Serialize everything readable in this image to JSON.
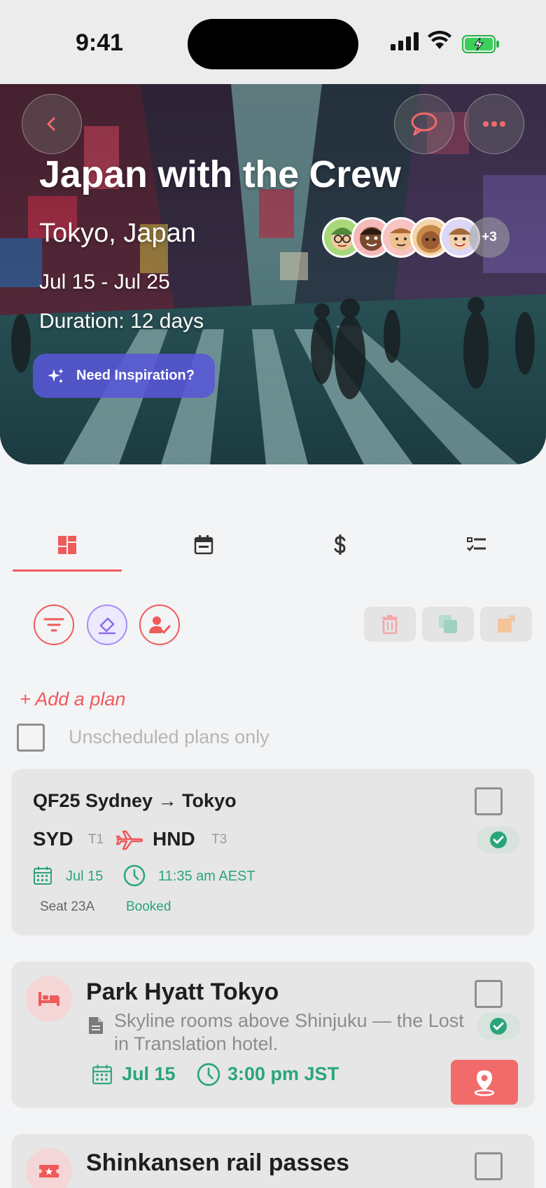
{
  "status_bar": {
    "time": "9:41"
  },
  "hero": {
    "title": "Japan with the Crew",
    "location": "Tokyo, Japan",
    "dates": "Jul 15 - Jul 25",
    "duration": "Duration: 12 days",
    "inspire_label": "Need Inspiration?",
    "more_avatars": "+3"
  },
  "tabs": [
    "dashboard-icon",
    "calendar-icon",
    "dollar-icon",
    "checklist-icon"
  ],
  "add_plan": "+ Add a plan",
  "unscheduled_label": "Unscheduled plans only",
  "flight": {
    "title": "QF25 Sydney → Tokyo",
    "from_code": "SYD",
    "from_term": "T1",
    "to_code": "HND",
    "to_term": "T3",
    "date": "Jul 15",
    "time": "11:35 am AEST",
    "seat": "Seat 23A",
    "status": "Booked"
  },
  "hotel": {
    "title": "Park Hyatt Tokyo",
    "description": "Skyline rooms above Shinjuku — the Lost in Translation hotel.",
    "date": "Jul 15",
    "time": "3:00 pm JST"
  },
  "rail": {
    "title": "Shinkansen rail passes"
  },
  "colors": {
    "accent": "#ef5a5a",
    "green": "#2aa57a",
    "purple": "#5856d6"
  }
}
